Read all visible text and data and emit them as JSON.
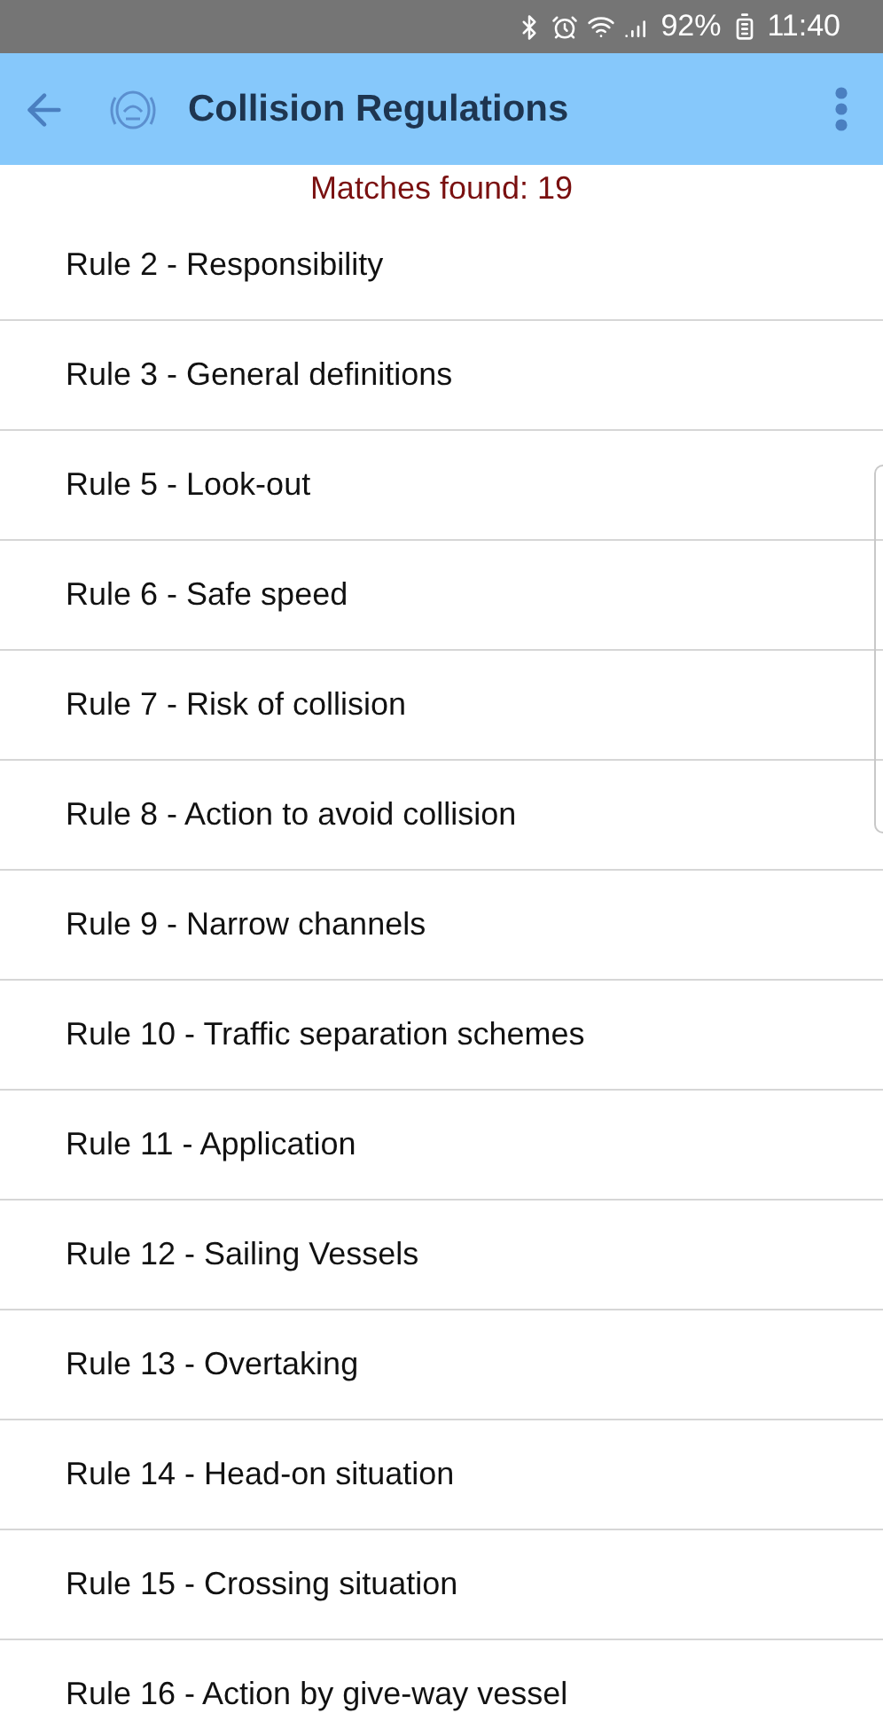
{
  "status_bar": {
    "battery_text": "92%",
    "time": "11:40"
  },
  "app_bar": {
    "title": "Collision Regulations"
  },
  "matches": "Matches found: 19",
  "rules": [
    "Rule 2 - Responsibility",
    "Rule 3 - General definitions",
    "Rule 5 - Look-out",
    "Rule 6 - Safe speed",
    "Rule 7 - Risk of collision",
    "Rule 8 - Action to avoid collision",
    "Rule 9 - Narrow channels",
    "Rule 10 - Traffic separation schemes",
    "Rule 11 - Application",
    "Rule 12 - Sailing Vessels",
    "Rule 13 - Overtaking",
    "Rule 14 - Head-on situation",
    "Rule 15 - Crossing situation",
    "Rule 16 - Action by give-way vessel"
  ]
}
